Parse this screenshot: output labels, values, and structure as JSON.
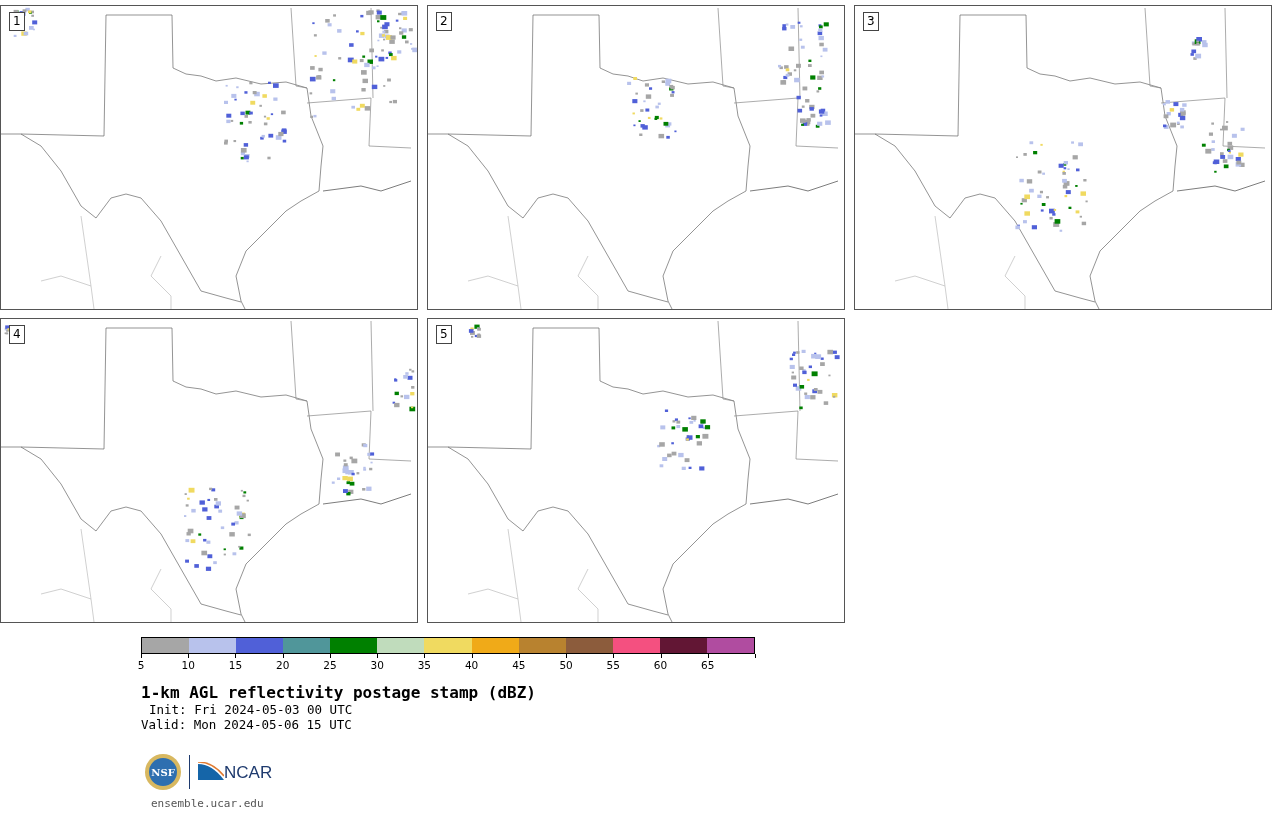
{
  "panels": [
    {
      "label": "1"
    },
    {
      "label": "2"
    },
    {
      "label": "3"
    },
    {
      "label": "4"
    },
    {
      "label": "5"
    }
  ],
  "colorbar": {
    "bins": [
      {
        "color": "#a6a6a6"
      },
      {
        "color": "#b8c2ec"
      },
      {
        "color": "#5060d8"
      },
      {
        "color": "#50969a"
      },
      {
        "color": "#008000"
      },
      {
        "color": "#c0dcbc"
      },
      {
        "color": "#f0da60"
      },
      {
        "color": "#f0aa18"
      },
      {
        "color": "#b8822f"
      },
      {
        "color": "#8c5c3c"
      },
      {
        "color": "#f45080"
      },
      {
        "color": "#621634"
      },
      {
        "color": "#b04ca0"
      }
    ],
    "ticks": [
      "5",
      "10",
      "15",
      "20",
      "25",
      "30",
      "35",
      "40",
      "45",
      "50",
      "55",
      "60",
      "65"
    ]
  },
  "title": "1-km AGL reflectivity postage stamp (dBZ)",
  "init": "Init: Fri 2024-05-03 00 UTC",
  "valid": "Valid: Mon 2024-05-06 15 UTC",
  "logos": {
    "nsf": "NSF",
    "ncar": "NCAR"
  },
  "footer": "ensemble.ucar.edu"
}
